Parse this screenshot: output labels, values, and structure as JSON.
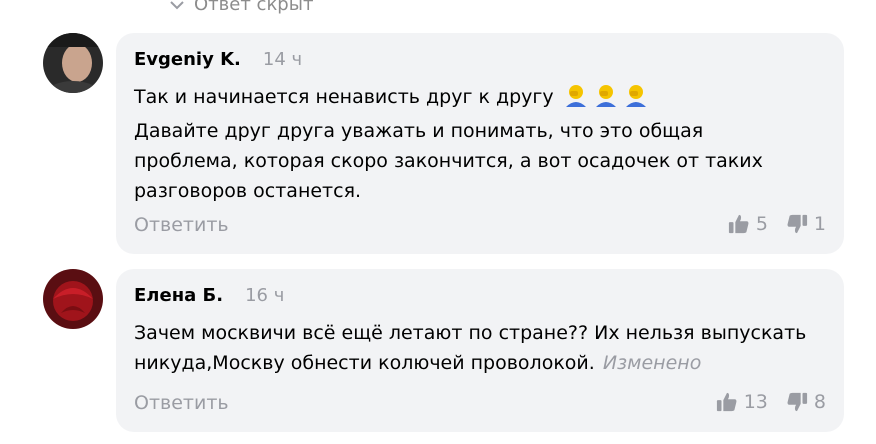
{
  "hidden_answer": {
    "label": "Ответ скрыт"
  },
  "comments": [
    {
      "author": "Evgeniy K.",
      "time": "14 ч",
      "lines": [
        "Так и начинается ненависть друг к другу",
        "Давайте друг друга уважать и понимать, что это общая",
        "проблема, которая скоро закончится, а вот осадочек от таких",
        "разговоров останется."
      ],
      "emoji_icon": "facepalm-icon",
      "reply_label": "Ответить",
      "likes": "5",
      "dislikes": "1"
    },
    {
      "author": "Елена Б.",
      "time": "16 ч",
      "lines": [
        "Зачем москвичи всё ещё летают по стране?? Их нельзя выпускать",
        "никуда,Москву обнести колючей проволокой."
      ],
      "edited_label": "Изменено",
      "reply_label": "Ответить",
      "likes": "13",
      "dislikes": "8"
    }
  ],
  "colors": {
    "bubble": "#f2f3f5",
    "muted": "#9a9ca3",
    "emoji_yellow": "#f5c400",
    "emoji_blue": "#3d6fd9"
  }
}
